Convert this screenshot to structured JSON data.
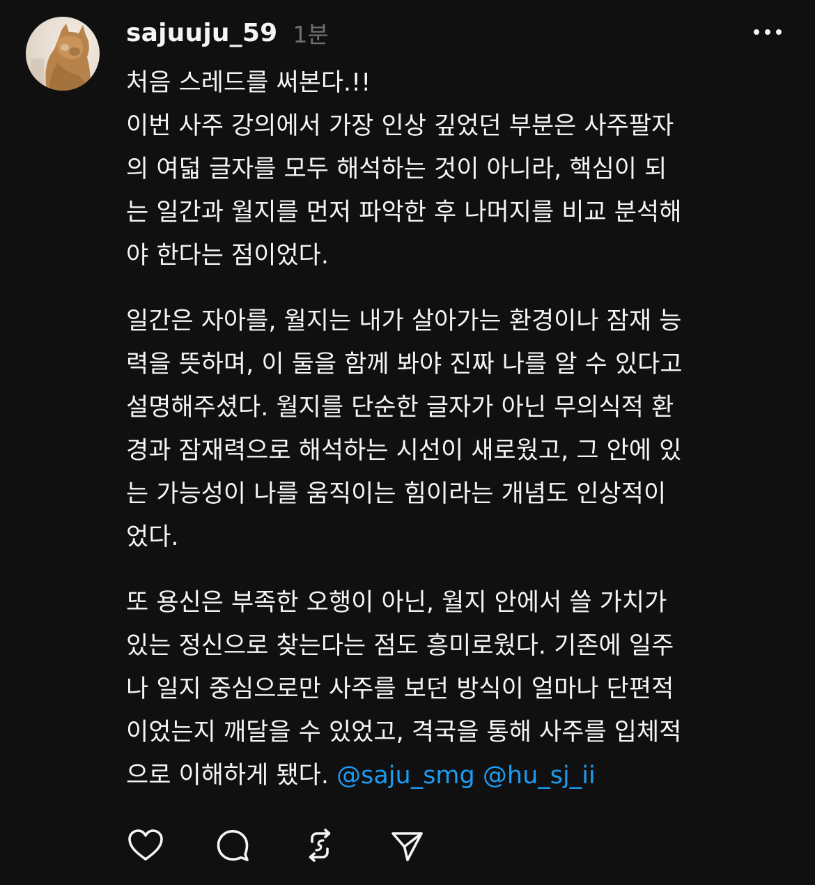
{
  "post": {
    "username": "sajuuju_59",
    "timestamp": "1분",
    "title_line": "처음 스레드를 써본다.!!",
    "paragraph1": [
      "이번 사주 강의에서 가장 인상 깊었던 부분은 사주팔자",
      "의 여덟 글자를 모두 해석하는 것이 아니라, 핵심이 되",
      "는 일간과 월지를 먼저 파악한 후 나머지를 비교 분석해",
      "야 한다는 점이었다."
    ],
    "paragraph2": [
      "일간은 자아를, 월지는 내가 살아가는 환경이나 잠재 능",
      "력을 뜻하며, 이 둘을 함께 봐야 진짜 나를 알 수 있다고",
      "설명해주셨다. 월지를 단순한 글자가 아닌 무의식적 환",
      "경과 잠재력으로 해석하는 시선이 새로웠고, 그 안에 있",
      "는 가능성이 나를 움직이는 힘이라는 개념도 인상적이",
      "었다."
    ],
    "paragraph3": [
      "또 용신은 부족한 오행이 아닌, 월지 안에서 쓸 가치가",
      "있는 정신으로 찾는다는 점도 흥미로웠다. 기존에 일주",
      "나 일지 중심으로만 사주를 보던 방식이 얼마나 단편적",
      "이었는지 깨달을 수 있었고, 격국을 통해 사주를 입체적"
    ],
    "last_line_text": "으로 이해하게 됐다. ",
    "mentions": [
      "@saju_smg",
      "@hu_sj_ii"
    ]
  },
  "icons": {
    "more": "more-dots-icon",
    "like": "heart-icon",
    "reply": "comment-bubble-icon",
    "repost": "repost-icon",
    "share": "send-icon"
  },
  "colors": {
    "background": "#101010",
    "text": "#f3f5f7",
    "muted": "#6f6f6f",
    "mention": "#1d9bf0"
  }
}
